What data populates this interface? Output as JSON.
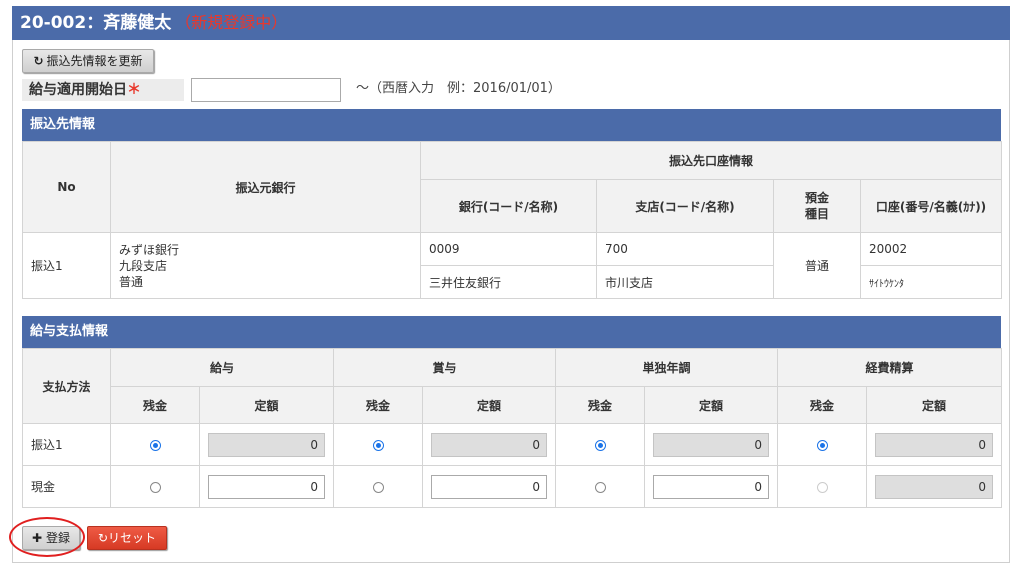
{
  "header": {
    "title": "20-002：斉藤健太",
    "status": "（新規登録中）"
  },
  "toolbar": {
    "refresh_icon": "↻",
    "refresh_label": "振込先情報を更新"
  },
  "start_date": {
    "label": "給与適用開始日",
    "required_mark": "＊",
    "value": "",
    "hint": "～（西暦入力　例：2016/01/01）"
  },
  "transfer": {
    "heading": "振込先情報",
    "headers": {
      "no": "No",
      "source_bank": "振込元銀行",
      "account_group": "振込先口座情報",
      "bank": "銀行(コード/名称)",
      "branch": "支店(コード/名称)",
      "deposit_type": "預金種目",
      "account": "口座(番号/名義(ｶﾅ))"
    },
    "row": {
      "no": "振込1",
      "source_bank_name": "みずほ銀行",
      "source_branch": "九段支店",
      "source_type": "普通",
      "bank_code": "0009",
      "bank_name": "三井住友銀行",
      "branch_code": "700",
      "branch_name": "市川支店",
      "deposit_type": "普通",
      "account_no": "20002",
      "account_holder_kana": "ｻｲﾄｳｹﾝﾀ"
    }
  },
  "payment": {
    "heading": "給与支払情報",
    "method_header": "支払方法",
    "groups": [
      "給与",
      "賞与",
      "単独年調",
      "経費精算"
    ],
    "sub_balance": "残金",
    "sub_fixed": "定額",
    "rows": [
      {
        "label": "振込1",
        "values": [
          "0",
          "0",
          "0",
          "0"
        ]
      },
      {
        "label": "現金",
        "values": [
          "0",
          "0",
          "0",
          "0"
        ]
      }
    ]
  },
  "actions": {
    "register_icon": "✚",
    "register_label": "登録",
    "reset_icon": "↻",
    "reset_label": "リセット"
  },
  "colors": {
    "header_bg": "#4b6ba9",
    "status_red": "#e8382c",
    "reset_red": "#d63a24",
    "radio_blue": "#1a73e8"
  }
}
